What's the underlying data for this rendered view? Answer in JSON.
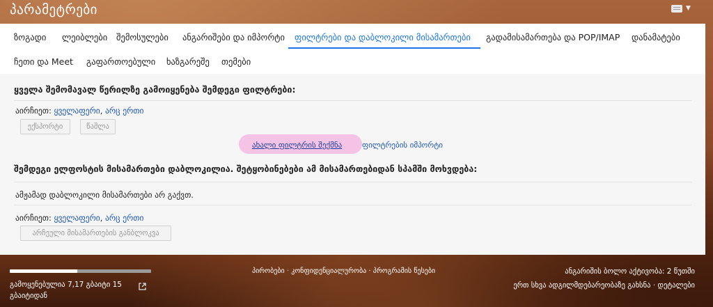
{
  "header": {
    "title": "პარამეტრები",
    "keyboard_icon": "keyboard-icon"
  },
  "tabs": [
    {
      "label": "ზოგადი"
    },
    {
      "label": "ლეიბლები"
    },
    {
      "label": "შემოსულები"
    },
    {
      "label": "ანგარიშები და იმპორტი"
    },
    {
      "label": "ფილტრები და დაბლოკილი მისამართები"
    },
    {
      "label": "გადამისამართება და POP/IMAP"
    },
    {
      "label": "დანამატები"
    },
    {
      "label": "ჩეთი და Meet"
    },
    {
      "label": "გაფართოებული"
    },
    {
      "label": "ხაზგარეშე"
    },
    {
      "label": "თემები"
    }
  ],
  "filters": {
    "heading": "ყველა შემომავალ წერილზე გამოიყენება შემდეგი ფილტრები:",
    "select_label": "აირჩიეთ:",
    "select_all": "ყველაფერი",
    "select_none": "არც ერთი",
    "export_button": "ექსპორტი",
    "delete_button": "წაშლა",
    "create_link": "ახალი ფილტრის შექმნა",
    "import_link": "ფილტრების იმპორტი"
  },
  "blocked": {
    "heading": "შემდეგი ელფოსტის მისამართები დაბლოკილია. შეტყობინებები ამ მისამართებიდან სპამში მოხვდება:",
    "empty_text": "ამჟამად დაბლოკილი მისამართები არ გაქვთ.",
    "select_label": "აირჩიეთ:",
    "select_all": "ყველაფერი",
    "select_none": "არც ერთი",
    "unblock_button": "არჩეული მისამართების განბლოკვა"
  },
  "footer": {
    "storage_line1": "გამოყენებულია 7,17 გბაიტი 15",
    "storage_line2": "გბაიტიდან",
    "storage_fraction": 0.478,
    "policy_links": "პირობები · კონფიდენციალურობა · პროგრამის წესები",
    "last_activity": "ანგარიშის ბოლო აქტივობა: 2 წუთში",
    "open_elsewhere": "ერთ სხვა ადგილმდებარეობაზე გახსნა · დეტალები"
  },
  "colors": {
    "accent": "#1a73e8",
    "link": "#1a55b8",
    "highlight": "#f4c3e6"
  }
}
